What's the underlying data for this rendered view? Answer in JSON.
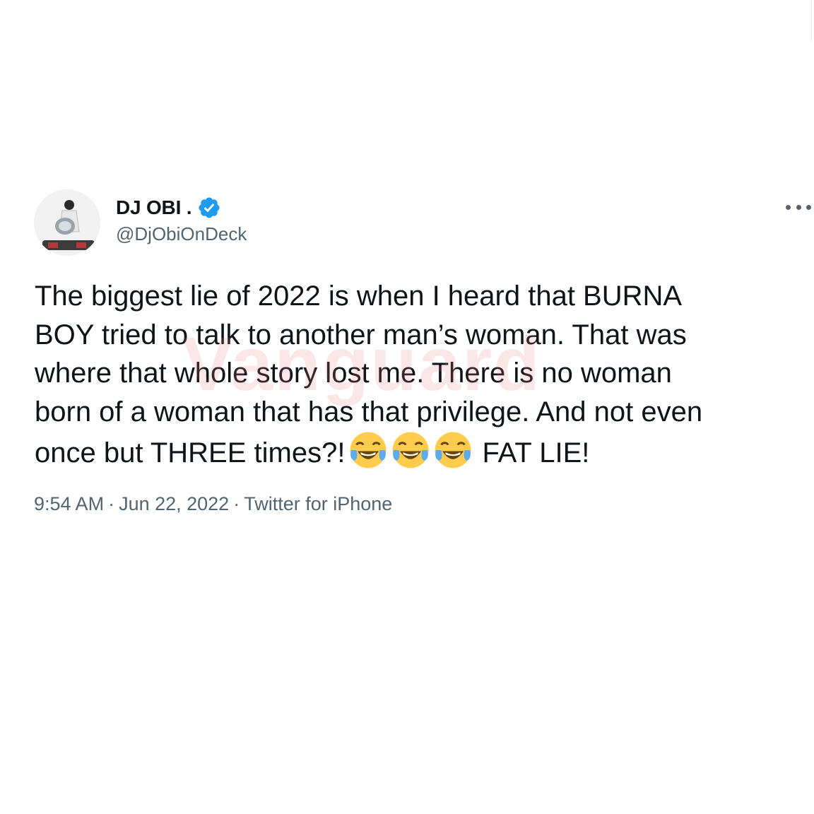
{
  "tweet": {
    "display_name": "DJ OBI .",
    "handle": "@DjObiOnDeck",
    "text_lines": [
      "The biggest lie of 2022 is when I heard that BURNA",
      "BOY tried to talk to another man’s woman. That was",
      "where that whole story lost me. There is no woman",
      "born of a woman that has that privilege. And not even"
    ],
    "last_line_start": "once but THREE times?!",
    "emojis": [
      "😂",
      "😂",
      "😂"
    ],
    "last_line_end": "FAT LIE!",
    "time": "9:54 AM",
    "date": "Jun 22, 2022",
    "source": "Twitter for iPhone",
    "separator": "·"
  },
  "watermark": "Vanguard",
  "icons": {
    "verified": "verified-badge-icon",
    "more": "more-options-icon",
    "emoji": "face-with-tears-of-joy-icon"
  },
  "colors": {
    "verified_blue": "#1d9bf0",
    "secondary_text": "#536471",
    "primary_text": "#0f1419"
  }
}
